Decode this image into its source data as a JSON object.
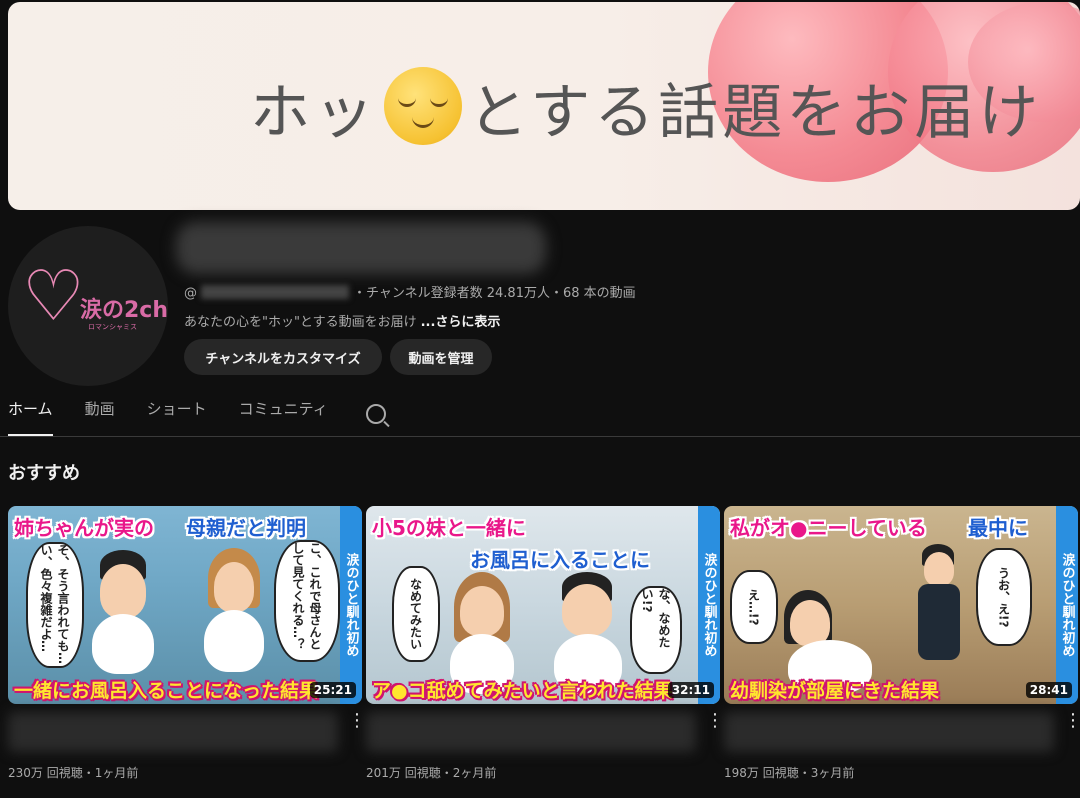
{
  "banner": {
    "text_before": "ホッ",
    "text_after": "とする話題をお届け"
  },
  "channel": {
    "logo_text": "涙の2ch",
    "logo_sub": "ロマンシャミス",
    "handle_prefix": "@",
    "subscribers": "・チャンネル登録者数 24.81万人・68 本の動画",
    "description": "あなたの心を\"ホッ\"とする動画をお届け",
    "more_label": "...さらに表示"
  },
  "buttons": {
    "customize": "チャンネルをカスタマイズ",
    "manage": "動画を管理"
  },
  "tabs": [
    {
      "label": "ホーム",
      "active": true
    },
    {
      "label": "動画",
      "active": false
    },
    {
      "label": "ショート",
      "active": false
    },
    {
      "label": "コミュニティ",
      "active": false
    }
  ],
  "section_title": "おすすめ",
  "videos": [
    {
      "title_top": "姉ちゃんが実の",
      "title_top2": "母親だと判明",
      "bubble_left": "そ、そう言われても…い、色々複雑だよ…",
      "bubble_right": "こ、これで母さんとして見てくれる…？",
      "title_bottom": "一緒にお風呂入ることになった結果",
      "side_tag": "涙のひと馴れ初め",
      "duration": "25:21",
      "stats": "230万 回視聴・1ヶ月前"
    },
    {
      "title_top": "小5の妹と一緒に",
      "title_top2": "お風呂に入ることに",
      "bubble_left": "なめてみたい",
      "bubble_right": "な、なめたい!?",
      "title_bottom": "ア●コ舐めてみたいと言われた結果",
      "side_tag": "涙のひと馴れ初め",
      "duration": "32:11",
      "stats": "201万 回視聴・2ヶ月前"
    },
    {
      "title_top": "私がオ●ニーしている",
      "title_top2": "最中に",
      "bubble_left": "え…!?",
      "bubble_right": "うお、え!?",
      "title_bottom": "幼馴染が部屋にきた結果",
      "side_tag": "涙のひと馴れ初め",
      "duration": "28:41",
      "stats": "198万 回視聴・3ヶ月前"
    }
  ]
}
